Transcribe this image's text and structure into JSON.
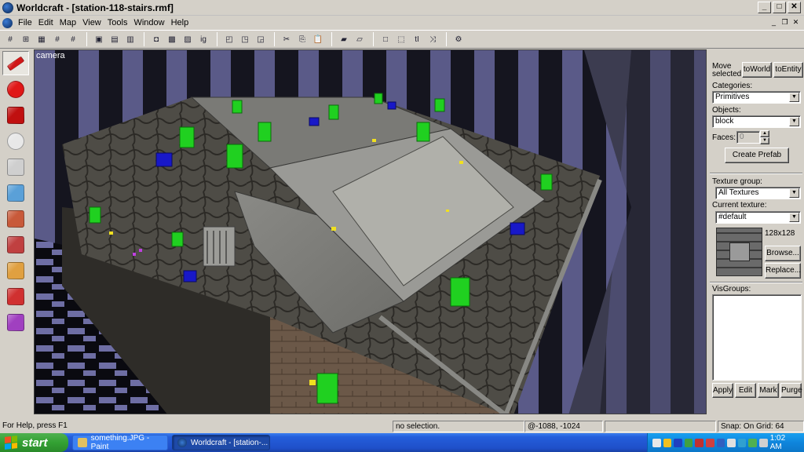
{
  "window": {
    "title": "Worldcraft - [station-118-stairs.rmf]",
    "controls": {
      "minimize": "_",
      "maximize": "□",
      "close": "✕"
    }
  },
  "menu": {
    "items": [
      "File",
      "Edit",
      "Map",
      "View",
      "Tools",
      "Window",
      "Help"
    ],
    "mdi_controls": {
      "minimize": "_",
      "restore": "❐",
      "close": "✕"
    }
  },
  "toolbar": {
    "buttons": [
      {
        "name": "grid-toggle-icon",
        "glyph": "#"
      },
      {
        "name": "grid-3d-icon",
        "glyph": "⊞"
      },
      {
        "name": "grid-snap-icon",
        "glyph": "▦"
      },
      {
        "name": "grid-smaller-icon",
        "glyph": "#"
      },
      {
        "name": "grid-larger-icon",
        "glyph": "#"
      },
      {
        "name": "load-window-icon",
        "glyph": "▣"
      },
      {
        "name": "save-window-icon",
        "glyph": "▤"
      },
      {
        "name": "window-state-icon",
        "glyph": "▥"
      },
      {
        "name": "cube-icon",
        "glyph": "◘"
      },
      {
        "name": "texture-lock-icon",
        "glyph": "▩"
      },
      {
        "name": "texture-app-icon",
        "glyph": "▨"
      },
      {
        "name": "ignore-groups-icon",
        "glyph": "ig"
      },
      {
        "name": "hide-selected-icon",
        "glyph": "◰"
      },
      {
        "name": "show-all-icon",
        "glyph": "◳"
      },
      {
        "name": "group-icon",
        "glyph": "◲"
      },
      {
        "name": "cut-icon",
        "glyph": "✂"
      },
      {
        "name": "copy-icon",
        "glyph": "⎘"
      },
      {
        "name": "paste-icon",
        "glyph": "📋"
      },
      {
        "name": "carve-icon",
        "glyph": "▰"
      },
      {
        "name": "hollow-icon",
        "glyph": "▱"
      },
      {
        "name": "selection-box-icon",
        "glyph": "□"
      },
      {
        "name": "select-icon",
        "glyph": "⬚"
      },
      {
        "name": "tie-icon",
        "glyph": "tI"
      },
      {
        "name": "move-icon",
        "glyph": "⤨"
      },
      {
        "name": "run-map-icon",
        "glyph": "⚙"
      }
    ],
    "separators_after": [
      4,
      7,
      11,
      14,
      17,
      19,
      23
    ]
  },
  "tools": [
    {
      "name": "selection-tool-icon",
      "color": "#d01818",
      "active": true
    },
    {
      "name": "magnify-tool-icon",
      "color": "#e01818"
    },
    {
      "name": "camera-tool-icon",
      "color": "#c01010"
    },
    {
      "name": "entity-tool-icon",
      "color": "#e8e8e8"
    },
    {
      "name": "block-tool-icon",
      "color": "#cfcfcf"
    },
    {
      "name": "texture-application-tool-icon",
      "color": "#5aa0d8"
    },
    {
      "name": "apply-current-texture-tool-icon",
      "color": "#c85a3a"
    },
    {
      "name": "decal-tool-icon",
      "color": "#c04040"
    },
    {
      "name": "clipping-tool-icon",
      "color": "#e0a040"
    },
    {
      "name": "vertex-manipulation-tool-icon",
      "color": "#d03030"
    },
    {
      "name": "path-tool-icon",
      "color": "#a040c0"
    }
  ],
  "viewport": {
    "label": "camera"
  },
  "panel": {
    "move_selected_label": "Move selected:",
    "to_world_button": "toWorld",
    "to_entity_button": "toEntity",
    "categories_label": "Categories:",
    "categories_value": "Primitives",
    "objects_label": "Objects:",
    "objects_value": "block",
    "faces_label": "Faces:",
    "faces_value": "0",
    "create_prefab_button": "Create Prefab",
    "texture_group_label": "Texture group:",
    "texture_group_value": "All Textures",
    "current_texture_label": "Current texture:",
    "current_texture_value": "#default",
    "texture_size": "128x128",
    "browse_button": "Browse...",
    "replace_button": "Replace...",
    "visgroups_label": "VisGroups:",
    "apply_button": "Apply",
    "edit_button": "Edit",
    "mark_button": "Mark",
    "purge_button": "Purge"
  },
  "status": {
    "help": "For Help, press F1",
    "selection": "no selection.",
    "coords": "@-1088, -1024",
    "snap": "Snap: On Grid: 64"
  },
  "taskbar": {
    "start": "start",
    "tasks": [
      {
        "label": "something.JPG - Paint",
        "active": false
      },
      {
        "label": "Worldcraft - [station-...",
        "active": true
      }
    ],
    "clock": "1:02 AM",
    "tray_colors": [
      "#e8e8e8",
      "#f0c020",
      "#2040c0",
      "#40a040",
      "#c03030",
      "#d04040",
      "#3060c0",
      "#e0e0e0",
      "#30a0d0",
      "#50b050",
      "#d0d0d0"
    ]
  }
}
